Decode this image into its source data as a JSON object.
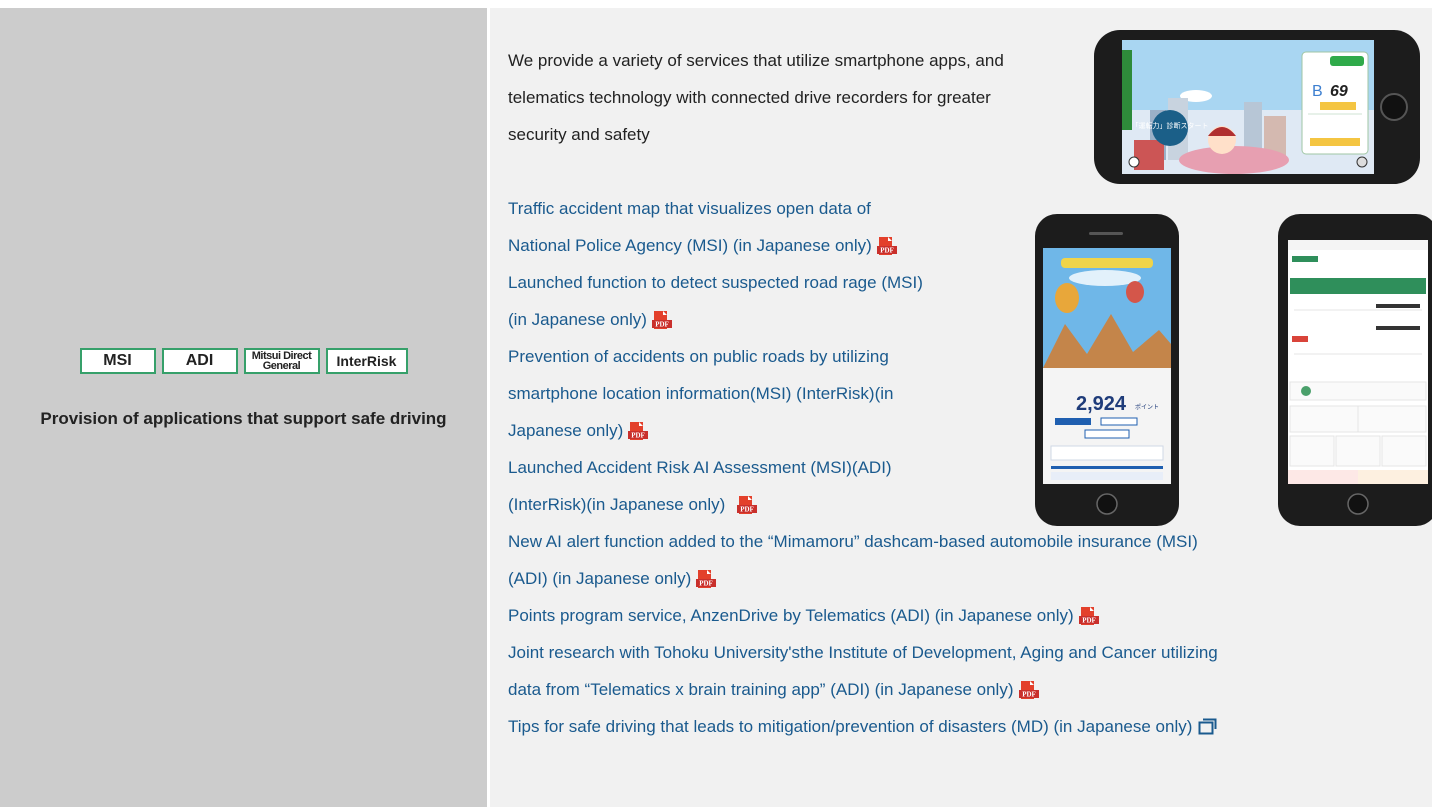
{
  "left": {
    "badges": [
      "MSI",
      "ADI",
      "Mitsui Direct",
      "General",
      "InterRisk"
    ],
    "title": "Provision of applications that support safe driving",
    "badge_color": "#36a06a"
  },
  "right": {
    "intro": "We provide a variety of services that utilize smartphone apps, and telematics technology with connected drive recorders for greater security and safety",
    "link_color": "#1a5a8e",
    "links": [
      {
        "line1": "Traffic accident map that visualizes open data of",
        "line2": "National Police Agency (MSI) (in Japanese only)",
        "icon": "pdf-icon"
      },
      {
        "line1": "Launched function to detect suspected road rage (MSI)",
        "line2": "(in Japanese only)",
        "icon": "pdf-icon"
      },
      {
        "line1": "Prevention of accidents on public roads by utilizing",
        "line2": "smartphone location information(MSI) (InterRisk)(in",
        "line3": "Japanese only)",
        "icon": "pdf-icon"
      },
      {
        "line1": "Launched Accident Risk AI Assessment (MSI)(ADI)",
        "line2": "(InterRisk)(in Japanese only)",
        "icon": "pdf-icon"
      },
      {
        "line1": "New AI alert function added to the “Mimamoru” dashcam-based automobile insurance (MSI)",
        "line2": "(ADI) (in Japanese only)",
        "icon": "pdf-icon"
      },
      {
        "line1": "Points program service, AnzenDrive by Telematics (ADI) (in Japanese only)",
        "icon": "pdf-icon"
      },
      {
        "line1": "Joint research with Tohoku University'sthe Institute of Development, Aging and Cancer utilizing",
        "line2": "data from “Telematics x brain training app” (ADI) (in Japanese only)",
        "icon": "pdf-icon"
      },
      {
        "line1": "Tips for safe driving that leads to mitigation/prevention of disasters (MD) (in Japanese only)",
        "icon": "external-window-icon"
      }
    ],
    "phone_screen": {
      "score_letter": "B",
      "score_value": "69",
      "points": "2,924",
      "points_unit": "ポイント",
      "diag_button": "「運転力」診断スタート"
    }
  }
}
